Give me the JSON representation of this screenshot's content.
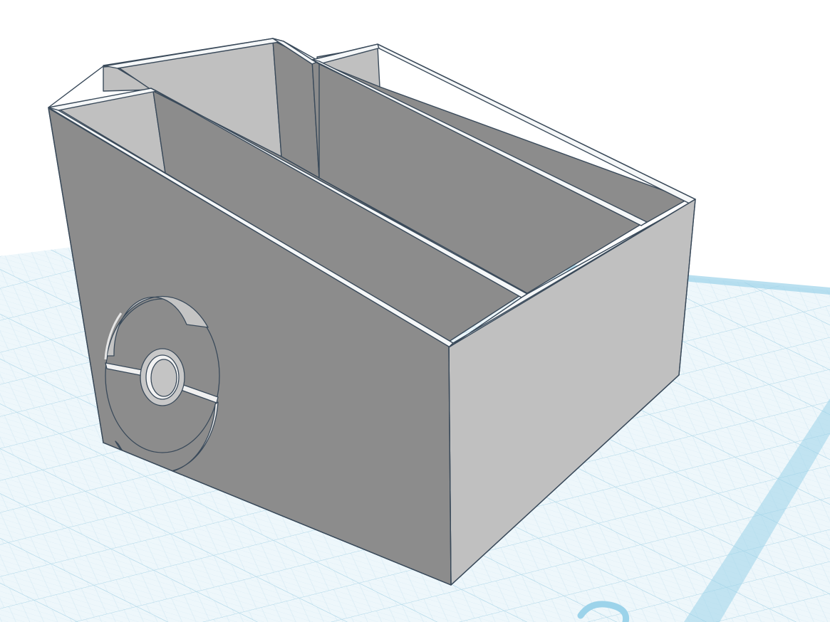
{
  "viewport": {
    "background_color": "#ffffff",
    "workplane": {
      "fill_color": "#eef7fb",
      "minor_grid_color": "#cfe6f1",
      "major_grid_color": "#9fcfe3",
      "edge_band_color": "#9cd3ea"
    }
  },
  "model": {
    "shape": "three-compartment box with angled front",
    "colors": {
      "dark_face": "#8c8c8c",
      "light_face": "#c0c0c0",
      "rim": "#f5f7f8",
      "outline": "#3a4a5a"
    },
    "compartment_count": 3,
    "front_emblem": "pokeball-icon"
  }
}
